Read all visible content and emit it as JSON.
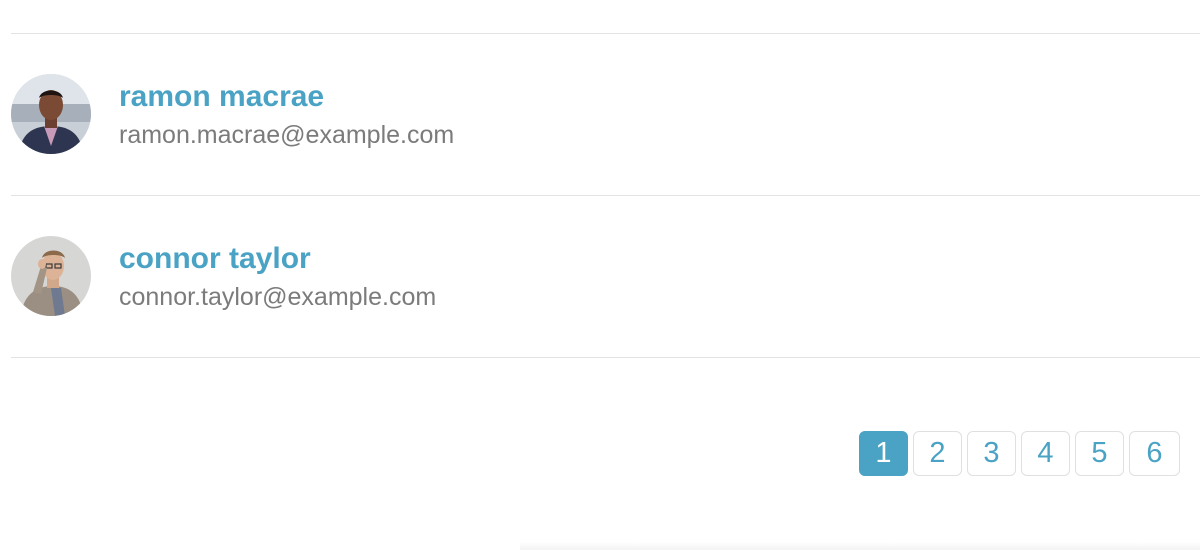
{
  "users": [
    {
      "name": "ramon macrae",
      "email": "ramon.macrae@example.com"
    },
    {
      "name": "connor taylor",
      "email": "connor.taylor@example.com"
    }
  ],
  "pagination": {
    "pages": [
      "1",
      "2",
      "3",
      "4",
      "5",
      "6"
    ],
    "current": "1"
  },
  "colors": {
    "accent": "#4aa3c4",
    "email_text": "#7b7b7b",
    "divider": "#e3e3e3"
  }
}
